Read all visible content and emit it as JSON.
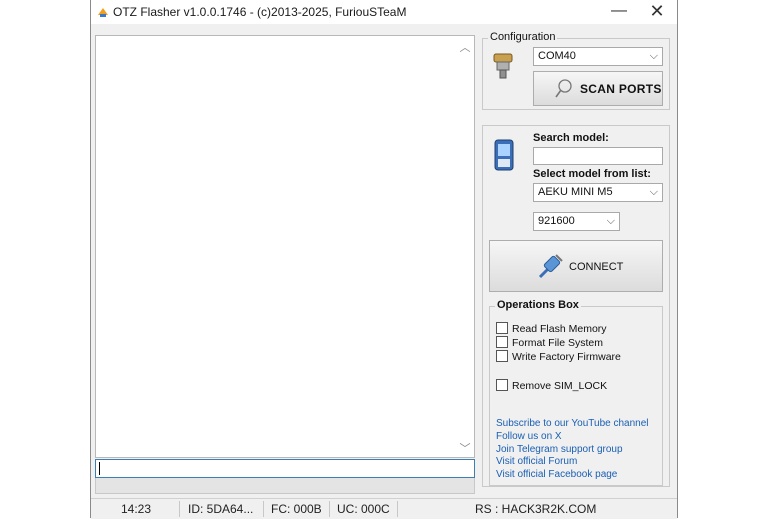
{
  "window": {
    "title": "OTZ Flasher v1.0.0.1746 - (c)2013-2025, FuriouSTeaM",
    "minimize": "—",
    "close": "✕"
  },
  "configuration": {
    "legend": "Configuration",
    "port_value": "COM40",
    "scan_label": "SCAN PORTS"
  },
  "model": {
    "search_label": "Search model:",
    "search_value": "",
    "select_label": "Select model from list:",
    "model_value": "AEKU MINI M5",
    "baud_value": "921600",
    "connect_label": "CONNECT"
  },
  "operations": {
    "legend": "Operations Box",
    "items": [
      {
        "label": "Read Flash Memory",
        "checked": false
      },
      {
        "label": "Format File System",
        "checked": false
      },
      {
        "label": "Write Factory Firmware",
        "checked": false
      },
      {
        "label": "Remove SIM_LOCK",
        "checked": false
      }
    ]
  },
  "links": [
    "Subscribe to our YouTube channel",
    "Follow us on X",
    "Join Telegram support group",
    "Visit official Forum",
    "Visit official Facebook page"
  ],
  "status": {
    "time": "14:23",
    "id": "ID: 5DA64...",
    "fc": "FC: 000B",
    "uc": "UC: 000C",
    "rs": "RS : HACK3R2K.COM"
  },
  "colors": {
    "link": "#1a5fb4",
    "focus_border": "#3c7fb1"
  }
}
